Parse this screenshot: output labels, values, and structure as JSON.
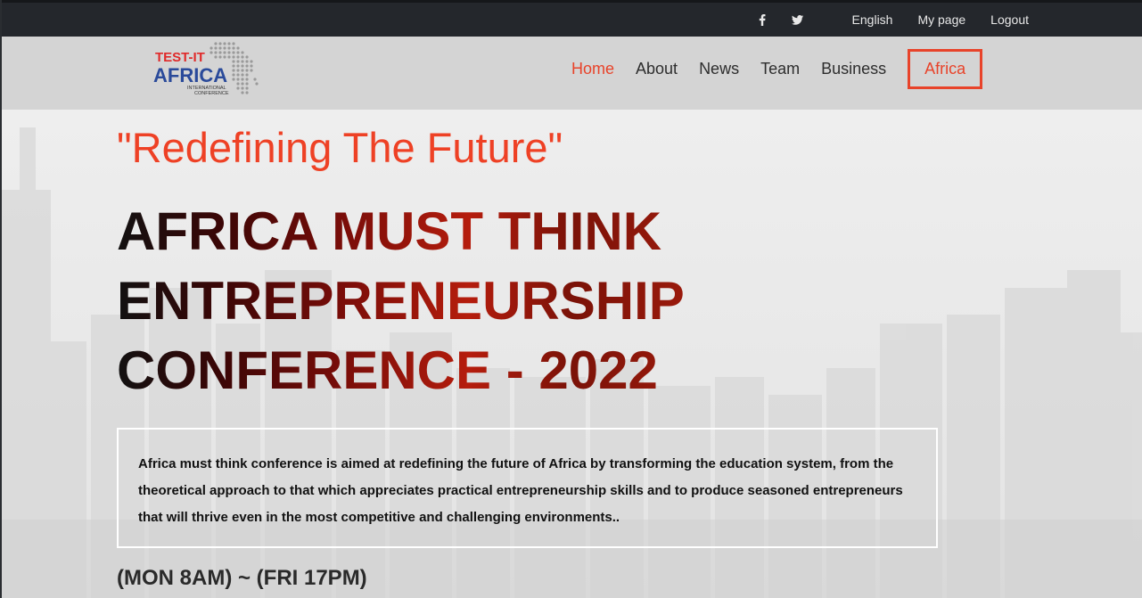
{
  "topbar": {
    "icons": [
      "facebook-icon",
      "twitter-icon"
    ],
    "links": [
      "English",
      "My page",
      "Logout"
    ]
  },
  "logo": {
    "line1": "TEST-IT",
    "line2": "AFRICA",
    "line3": "INTERNATIONAL",
    "line4": "CONFERENCE"
  },
  "nav": {
    "items": [
      "Home",
      "About",
      "News",
      "Team",
      "Business",
      "Africa"
    ],
    "active": "Home",
    "highlighted": "Africa"
  },
  "hero": {
    "tagline": "\"Redefining The Future\"",
    "headline": [
      "AFRICA MUST THINK",
      "ENTREPRENEURSHIP",
      "CONFERENCE - 2022"
    ],
    "description": "Africa must think conference is aimed at redefining the future of Africa by transforming the education system, from the theoretical approach to that which appreciates practical entrepreneurship skills and to produce seasoned entrepreneurs that will thrive even in the most competitive and challenging environments..",
    "schedule": "(MON 8AM) ~ (FRI 17PM)"
  },
  "colors": {
    "accent": "#e8432a",
    "topbar": "#24272c",
    "header": "#d4d4d4"
  }
}
